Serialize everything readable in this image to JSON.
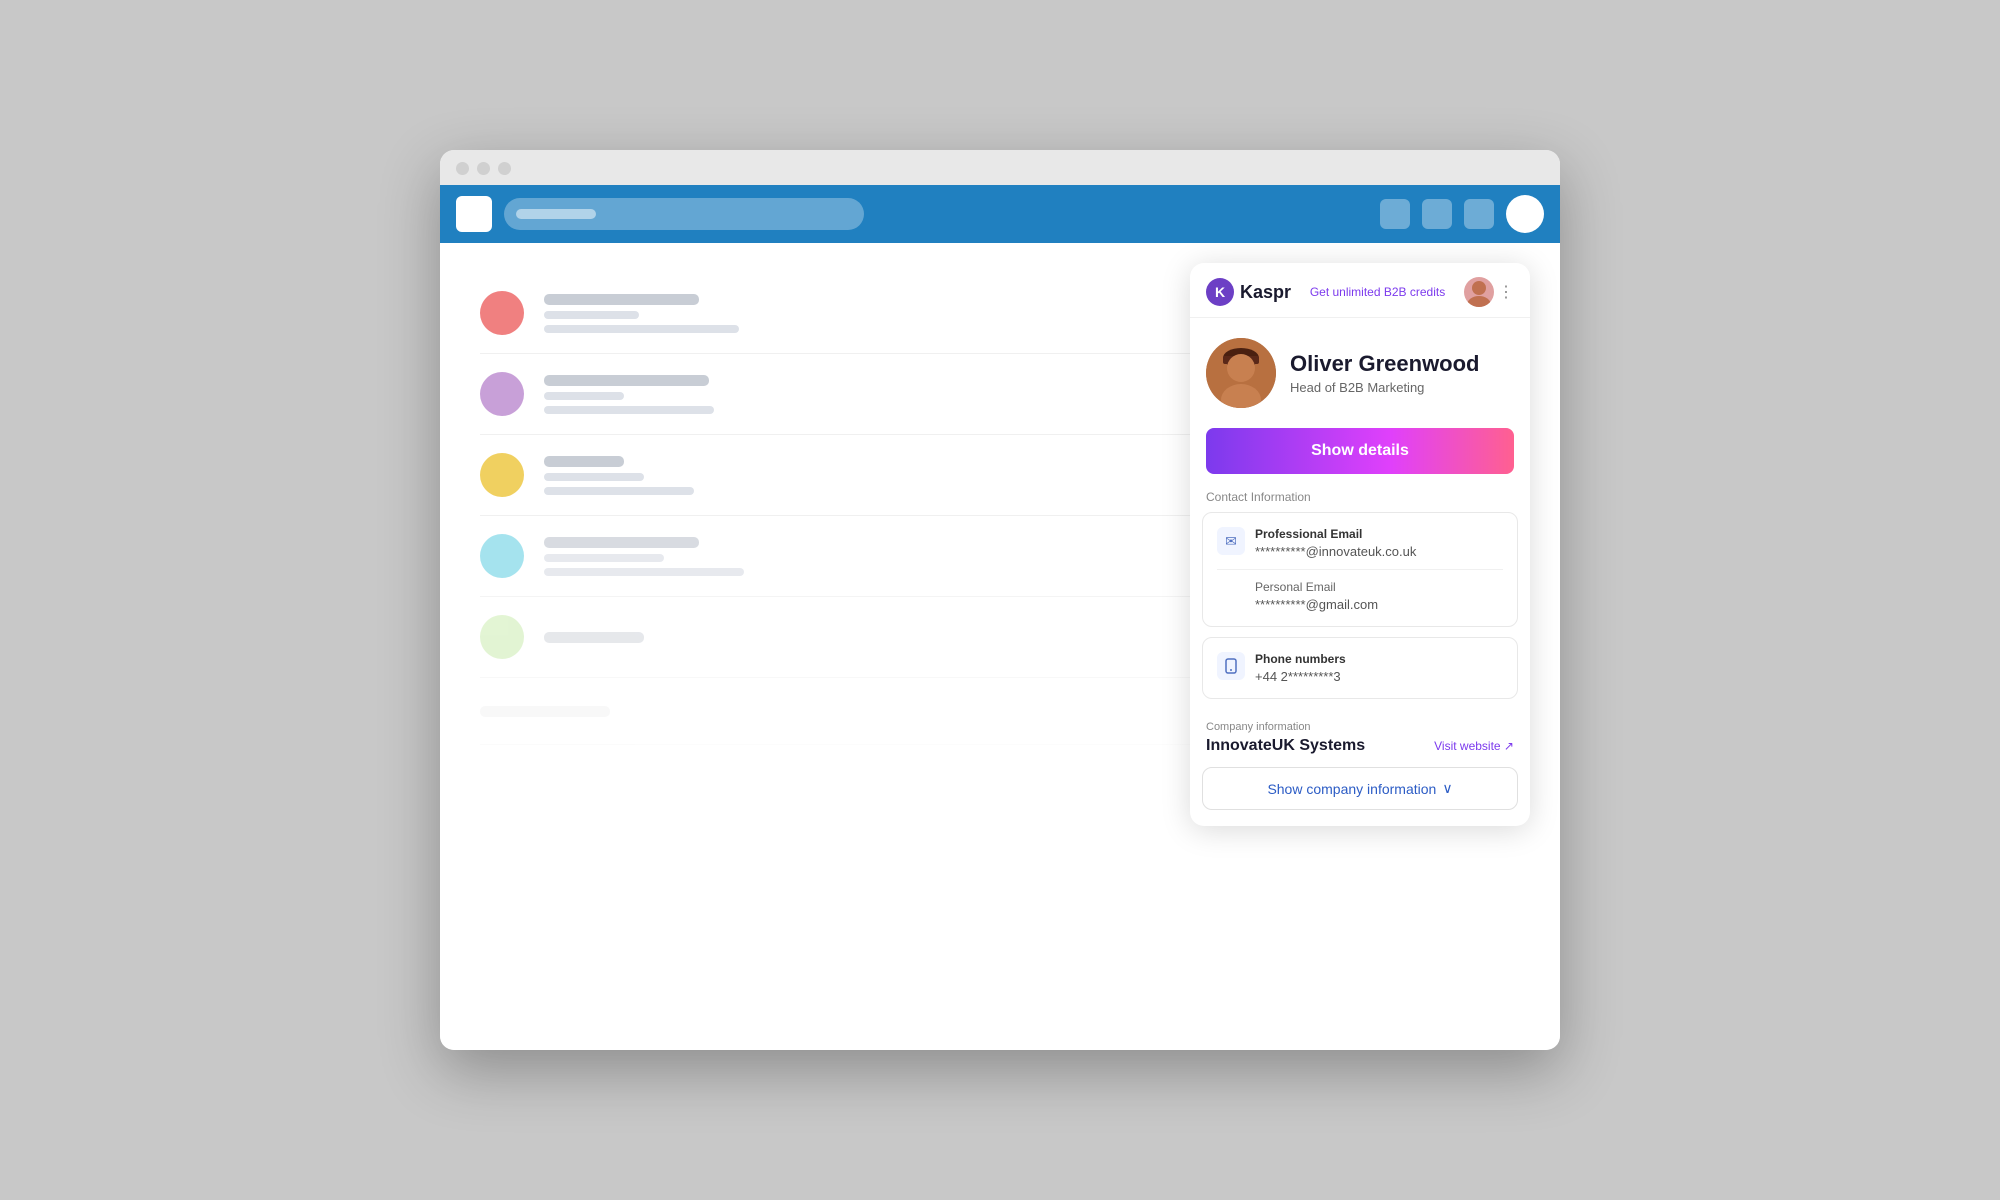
{
  "browser": {
    "traffic_lights": [
      "close",
      "minimize",
      "maximize"
    ],
    "logo_label": "logo",
    "url_placeholder": "url",
    "nav_icons": [
      "grid-icon",
      "apps-icon",
      "more-icon"
    ],
    "avatar_label": "user-avatar"
  },
  "list": {
    "rows": [
      {
        "avatar_color": "#f08080",
        "name_width": 155,
        "sub1_width": 95,
        "sub2_width": 195,
        "tag": true,
        "btn": "primary"
      },
      {
        "avatar_color": "#c8a0d8",
        "name_width": 165,
        "sub1_width": 80,
        "sub2_width": 170,
        "tag": true,
        "btn": "primary"
      },
      {
        "avatar_color": "#f0d060",
        "name_width": 80,
        "sub1_width": 100,
        "sub2_width": 150,
        "tag": true,
        "btn": "faded"
      },
      {
        "avatar_color": "#80d8e8",
        "name_width": 155,
        "sub1_width": 120,
        "sub2_width": 200,
        "tag": true,
        "btn": "faded"
      },
      {
        "avatar_color": "#c0e8a0",
        "name_width": 100,
        "sub1_width": 0,
        "sub2_width": 0,
        "tag": false,
        "btn": "very-faded"
      }
    ]
  },
  "kaspr": {
    "logo_letter": "K",
    "logo_name": "Kaspr",
    "credits_link": "Get unlimited B2B credits",
    "menu_icon": "⋮",
    "profile": {
      "name": "Oliver Greenwood",
      "title": "Head of B2B Marketing"
    },
    "show_details_label": "Show details",
    "contact_section_label": "Contact Information",
    "email_card": {
      "icon": "✉",
      "professional_label": "Professional Email",
      "professional_value": "**********@innovateuk.co.uk",
      "personal_label": "Personal Email",
      "personal_value": "**********@gmail.com"
    },
    "phone_card": {
      "icon": "📱",
      "label": "Phone numbers",
      "value": "+44 2*********3"
    },
    "company_section": {
      "section_label": "Company information",
      "company_name": "InnovateUK Systems",
      "visit_website_label": "Visit website ↗"
    },
    "show_company_label": "Show company information",
    "chevron": "∨"
  }
}
